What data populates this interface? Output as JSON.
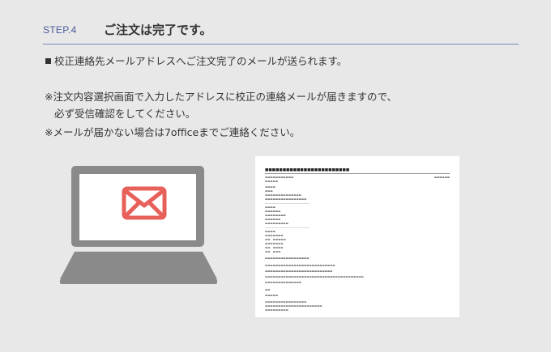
{
  "step": {
    "number": "STEP.4",
    "title": "ご注文は完了です。"
  },
  "bullet_text": "校正連絡先メールアドレスへご注文完了のメールが送られます。",
  "notes": {
    "line1": "※注文内容選択画面で入力したアドレスに校正の連絡メールが届きますので、",
    "line2": "必ず受信確認をしてください。",
    "line3": "※メールが届かない場合は7officeまでご連絡ください。"
  },
  "icons": {
    "laptop": "laptop-icon",
    "envelope": "envelope-icon"
  },
  "colors": {
    "background": "#e8e8e8",
    "step_accent": "#4a5a9a",
    "laptop_gray": "#8a8a8a",
    "envelope_red": "#e8605a"
  }
}
